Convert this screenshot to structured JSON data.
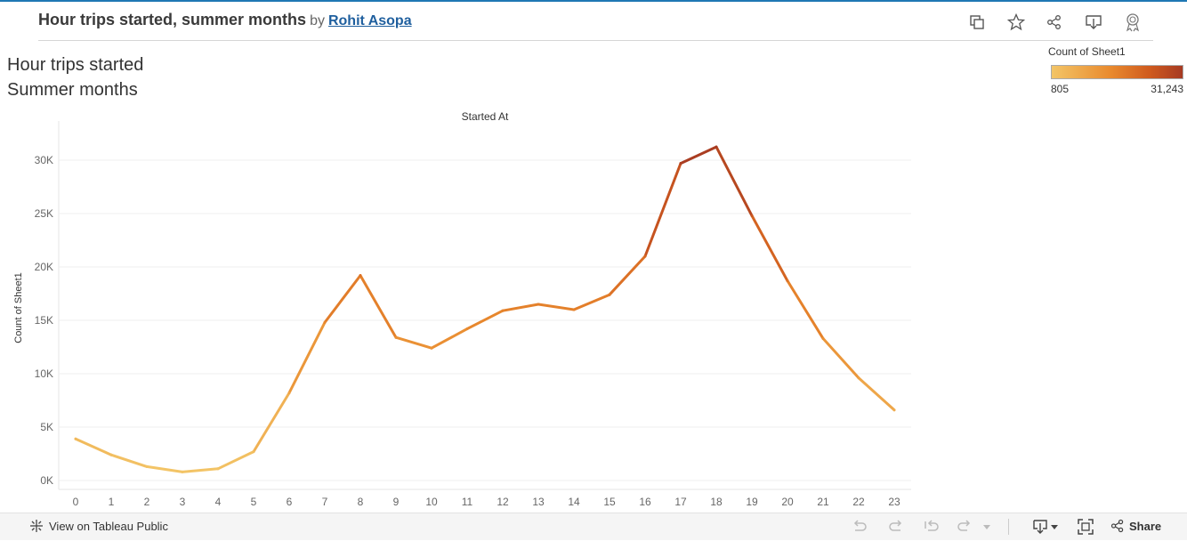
{
  "header": {
    "title": "Hour trips started, summer months",
    "by": "by",
    "author": "Rohit Asopa"
  },
  "viz_title": {
    "line1": "Hour trips started",
    "line2": "Summer months"
  },
  "legend": {
    "title": "Count of Sheet1",
    "min": "805",
    "max": "31,243"
  },
  "footer": {
    "view_label": "View on Tableau Public",
    "share_label": "Share"
  },
  "icons": [
    "copy-icon",
    "star-icon",
    "share-nodes-icon",
    "download-icon",
    "award-icon",
    "undo-icon",
    "redo-icon",
    "revert-icon",
    "forward-icon",
    "download-menu-icon",
    "fullscreen-icon"
  ],
  "colors": {
    "low": "#f3c567",
    "mid": "#e98a2e",
    "high": "#a63a22",
    "accent": "#1f77b4"
  },
  "chart_data": {
    "type": "line",
    "title": "Started At",
    "xlabel": "",
    "ylabel": "Count of Sheet1",
    "categories": [
      "0",
      "1",
      "2",
      "3",
      "4",
      "5",
      "6",
      "7",
      "8",
      "9",
      "10",
      "11",
      "12",
      "13",
      "14",
      "15",
      "16",
      "17",
      "18",
      "19",
      "20",
      "21",
      "22",
      "23"
    ],
    "values": [
      3900,
      2400,
      1300,
      805,
      1100,
      2700,
      8200,
      14800,
      19200,
      13400,
      12400,
      14200,
      15900,
      16500,
      16000,
      17400,
      21000,
      29700,
      31243,
      24800,
      18700,
      13300,
      9600,
      6600
    ],
    "yticks": [
      0,
      5000,
      10000,
      15000,
      20000,
      25000,
      30000
    ],
    "ytick_labels": [
      "0K",
      "5K",
      "10K",
      "15K",
      "20K",
      "25K",
      "30K"
    ],
    "ylim": [
      0,
      33000
    ],
    "grid": true,
    "color_by": "value",
    "color_range": [
      805,
      31243
    ]
  }
}
